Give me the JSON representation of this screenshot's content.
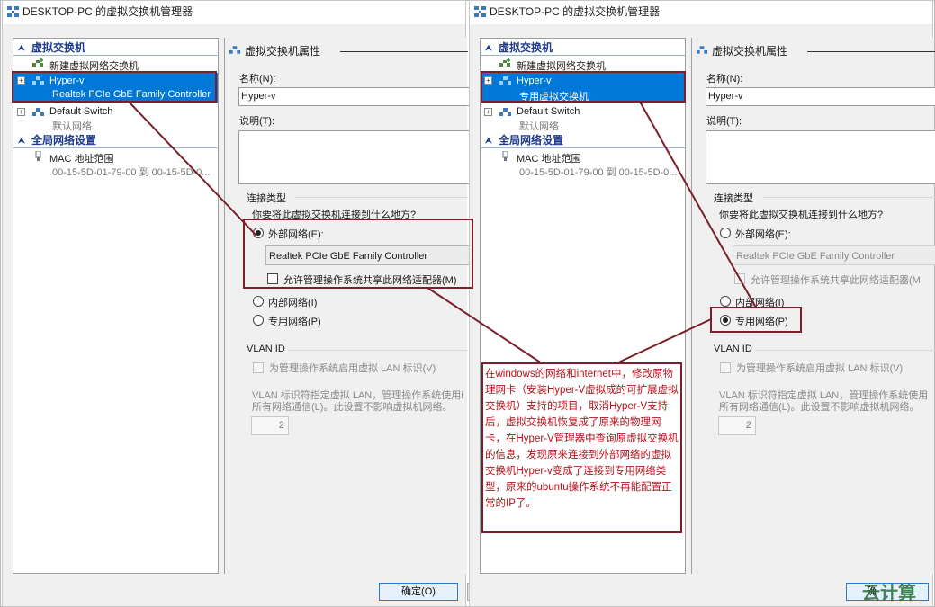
{
  "left_window": {
    "title": "DESKTOP-PC 的虚拟交换机管理器",
    "tree": {
      "section_switches": "虚拟交换机",
      "new_switch": "新建虚拟网络交换机",
      "hyperv_name": "Hyper-v",
      "hyperv_sub": "Realtek PCIe GbE Family Controller",
      "default_name": "Default Switch",
      "default_sub": "默认网络",
      "section_global": "全局网络设置",
      "mac_name": "MAC 地址范围",
      "mac_sub": "00-15-5D-01-79-00 到 00-15-5D-0..."
    },
    "props": {
      "header": "虚拟交换机属性",
      "name_label": "名称(N):",
      "name_value": "Hyper-v",
      "desc_label": "说明(T):",
      "conn_group": "连接类型",
      "conn_question": "你要将此虚拟交换机连接到什么地方?",
      "external": "外部网络(E):",
      "adapter": "Realtek PCIe GbE Family Controller",
      "allow_share": "允许管理操作系统共享此网络适配器(M)",
      "internal": "内部网络(I)",
      "private": "专用网络(P)",
      "vlan_group": "VLAN ID",
      "vlan_enable": "为管理操作系统启用虚拟 LAN 标识(V)",
      "vlan_desc1": "VLAN 标识符指定虚拟 LAN，管理操作系统使用i",
      "vlan_desc2": "所有网络通信(L)。此设置不影响虚拟机网络。",
      "vlan_value": "2",
      "selected": "external"
    },
    "ok_button": "确定(O)"
  },
  "right_window": {
    "title": "DESKTOP-PC 的虚拟交换机管理器",
    "tree": {
      "section_switches": "虚拟交换机",
      "new_switch": "新建虚拟网络交换机",
      "hyperv_name": "Hyper-v",
      "hyperv_sub": "专用虚拟交换机",
      "default_name": "Default Switch",
      "default_sub": "默认网络",
      "section_global": "全局网络设置",
      "mac_name": "MAC 地址范围",
      "mac_sub": "00-15-5D-01-79-00 到 00-15-5D-0..."
    },
    "props": {
      "header": "虚拟交换机属性",
      "name_label": "名称(N):",
      "name_value": "Hyper-v",
      "desc_label": "说明(T):",
      "conn_group": "连接类型",
      "conn_question": "你要将此虚拟交换机连接到什么地方?",
      "external": "外部网络(E):",
      "adapter": "Realtek PCIe GbE Family Controller",
      "allow_share": "允许管理操作系统共享此网络适配器(M",
      "internal": "内部网络(I)",
      "private": "专用网络(P)",
      "vlan_group": "VLAN ID",
      "vlan_enable": "为管理操作系统启用虚拟 LAN 标识(V)",
      "vlan_desc1": "VLAN 标识符指定虚拟 LAN，管理操作系统使用",
      "vlan_desc2": "所有网络通信(L)。此设置不影响虚拟机网络。",
      "vlan_value": "2",
      "selected": "private"
    },
    "ok_button": "确"
  },
  "annotation": "在windows的网络和internet中，修改原物理网卡（安装Hyper-V虚拟成的可扩展虚拟交换机）支持的项目，取消Hyper-V支持后，虚拟交换机恢复成了原来的物理网卡，在Hyper-V管理器中查询原虚拟交换机的信息，发现原来连接到外部网络的虚拟交换机Hyper-v变成了连接到专用网络类型，原来的ubuntu操作系统不再能配置正常的IP了。",
  "watermark": "云计算",
  "colors": {
    "selection": "#0078d7",
    "annotation_border": "#7a1f2b",
    "annotation_text": "#b5121b",
    "section_heading": "#1e3a8a"
  }
}
